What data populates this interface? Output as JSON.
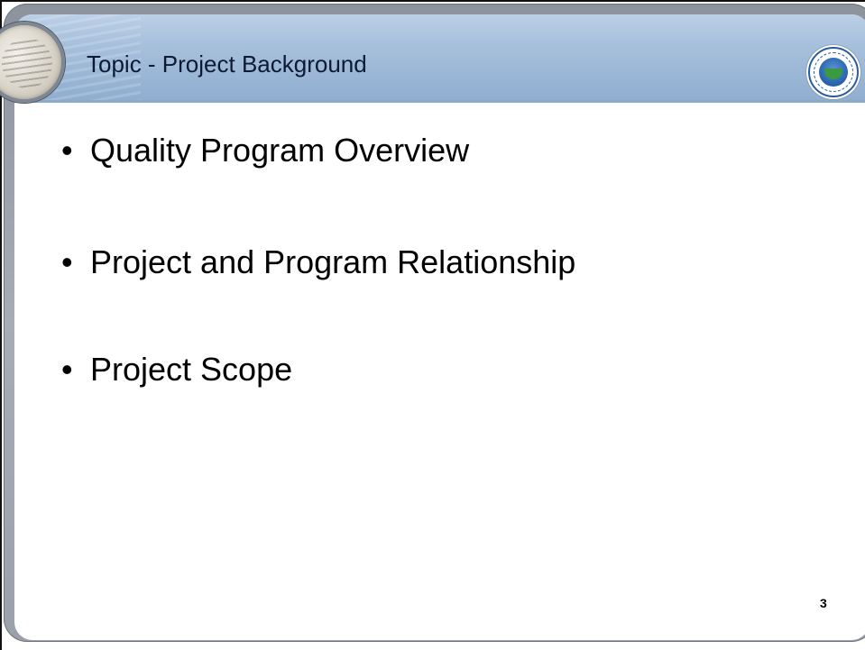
{
  "slide": {
    "title": "Topic - Project Background",
    "bullets": [
      "Quality Program Overview",
      "Project and Program Relationship",
      "Project Scope"
    ],
    "bullet_glyph": "•",
    "page_number": "3"
  },
  "icons": {
    "magnifier": "magnifying-glass-icon",
    "seal": "agency-seal-icon"
  },
  "colors": {
    "header_band": "#a7c0dc",
    "bezel": "#9aa1aa",
    "text": "#000000"
  }
}
